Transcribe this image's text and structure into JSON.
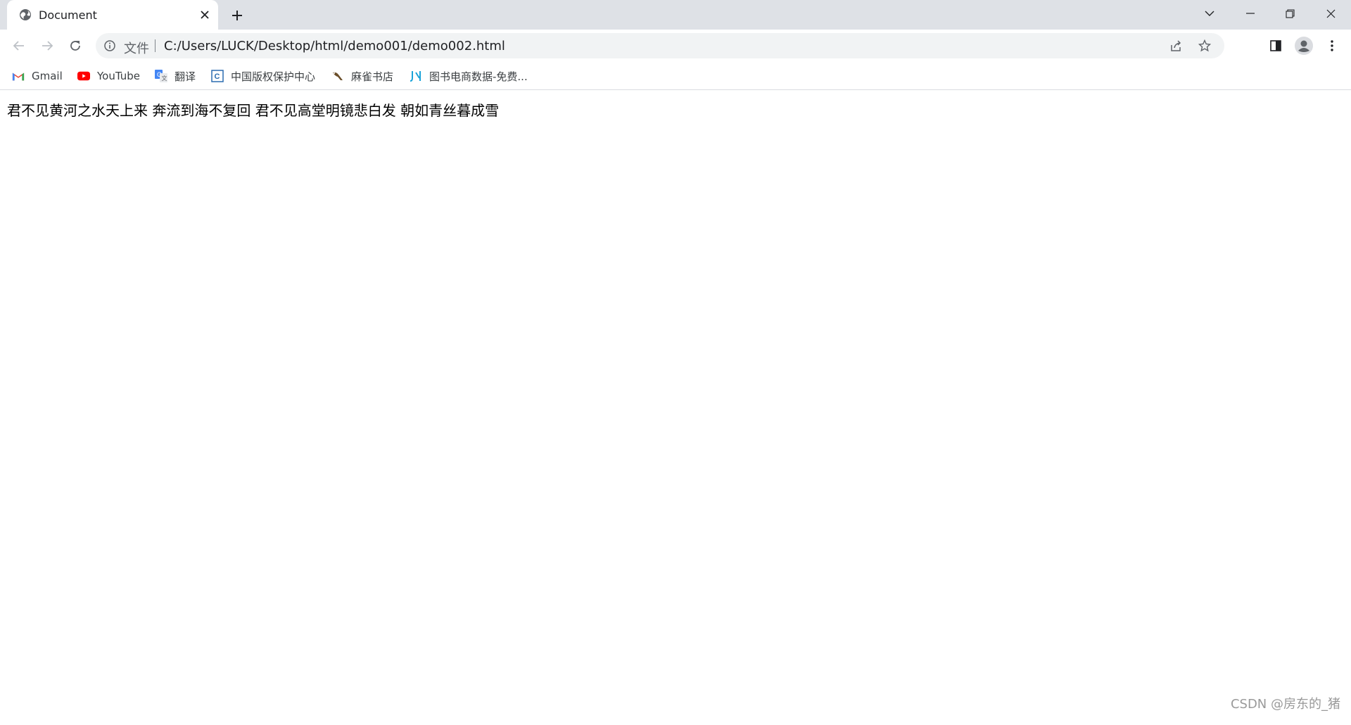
{
  "browser": {
    "tab": {
      "title": "Document",
      "favicon": "globe-icon"
    },
    "new_tab_icon": "plus-icon",
    "window_controls": [
      "tab-search-icon",
      "minimize-icon",
      "restore-icon",
      "close-icon"
    ]
  },
  "toolbar": {
    "buttons": [
      "back-arrow-icon",
      "forward-arrow-icon",
      "reload-icon"
    ],
    "omnibox": {
      "info_icon": "info-icon",
      "scheme_label": "文件",
      "url": "C:/Users/LUCK/Desktop/html/demo001/demo002.html",
      "actions": [
        "share-icon",
        "star-icon"
      ]
    },
    "right_buttons": [
      "side-panel-icon",
      "profile-avatar-icon",
      "more-vertical-icon"
    ]
  },
  "bookmarks": [
    {
      "label": "Gmail",
      "icon": "gmail-icon",
      "color": "#ea4335"
    },
    {
      "label": "YouTube",
      "icon": "youtube-icon",
      "color": "#ff0000"
    },
    {
      "label": "翻译",
      "icon": "translate-icon",
      "color": "#4285f4"
    },
    {
      "label": "中国版权保护中心",
      "icon": "copyright-center-icon",
      "color": "#2b6cb0"
    },
    {
      "label": "麻雀书店",
      "icon": "sparrow-icon",
      "color": "#6b4f2a"
    },
    {
      "label": "图书电商数据-免费...",
      "icon": "bookstore-data-icon",
      "color": "#1aa3d9"
    }
  ],
  "page": {
    "body_text": "君不见黄河之水天上来 奔流到海不复回 君不见高堂明镜悲白发 朝如青丝暮成雪"
  },
  "watermark": "CSDN @房东的_猪"
}
